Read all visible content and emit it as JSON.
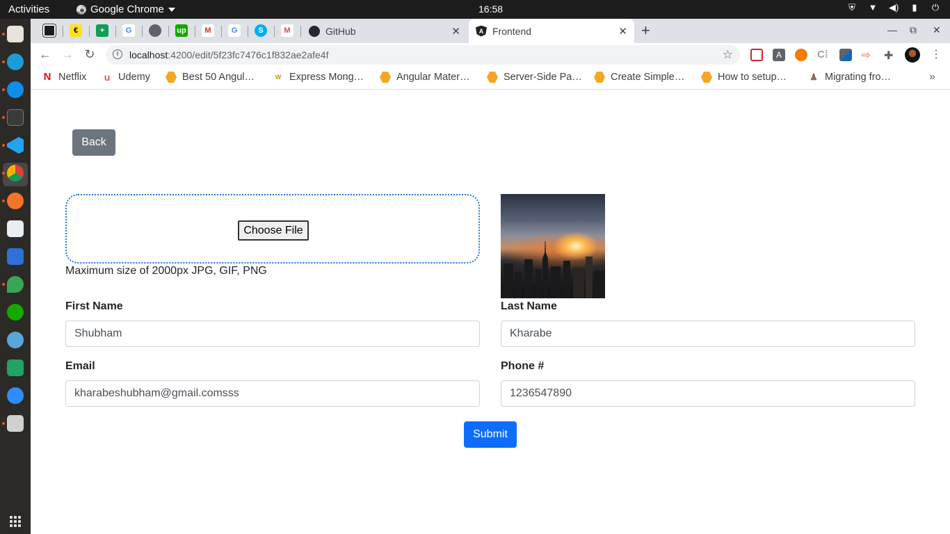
{
  "topbar": {
    "activities": "Activities",
    "app_name": "Google Chrome",
    "clock": "16:58"
  },
  "tabs": {
    "pinned_icons": [
      "trello-icon",
      "mailchimp-icon",
      "google-sheets-icon",
      "google-icon",
      "globe-icon",
      "upwork-icon",
      "gmail-icon",
      "google-icon",
      "skype-icon",
      "monday-icon"
    ],
    "github": {
      "title": "GitHub"
    },
    "active": {
      "title": "Frontend"
    }
  },
  "toolbar": {
    "url_host": "localhost",
    "url_path": ":4200/edit/5f23fc7476c1f832ae2afe4f"
  },
  "bookmarks": [
    {
      "label": "Netflix",
      "icon": "netflix-icon"
    },
    {
      "label": "Udemy",
      "icon": "udemy-icon"
    },
    {
      "label": "Best 50 Angul…",
      "icon": "hexagon-icon"
    },
    {
      "label": "Express Mong…",
      "icon": "w-icon"
    },
    {
      "label": "Angular Mater…",
      "icon": "hexagon-icon"
    },
    {
      "label": "Server-Side Pa…",
      "icon": "hexagon-icon"
    },
    {
      "label": "Create Simple…",
      "icon": "hexagon-icon"
    },
    {
      "label": "How to setup…",
      "icon": "hexagon-icon"
    },
    {
      "label": "Migrating fro…",
      "icon": "figure-icon"
    }
  ],
  "form": {
    "back_label": "Back",
    "choose_file_label": "Choose File",
    "file_hint": "Maximum size of 2000px JPG, GIF, PNG",
    "first_name_label": "First Name",
    "first_name_value": "Shubham",
    "last_name_label": "Last Name",
    "last_name_value": "Kharabe",
    "email_label": "Email",
    "email_value": "kharabeshubham@gmail.comsss",
    "phone_label": "Phone #",
    "phone_value": "1236547890",
    "submit_label": "Submit"
  },
  "colors": {
    "primary": "#0d6efd",
    "secondary": "#6c757d",
    "dropzone_border": "#1a73e8"
  }
}
